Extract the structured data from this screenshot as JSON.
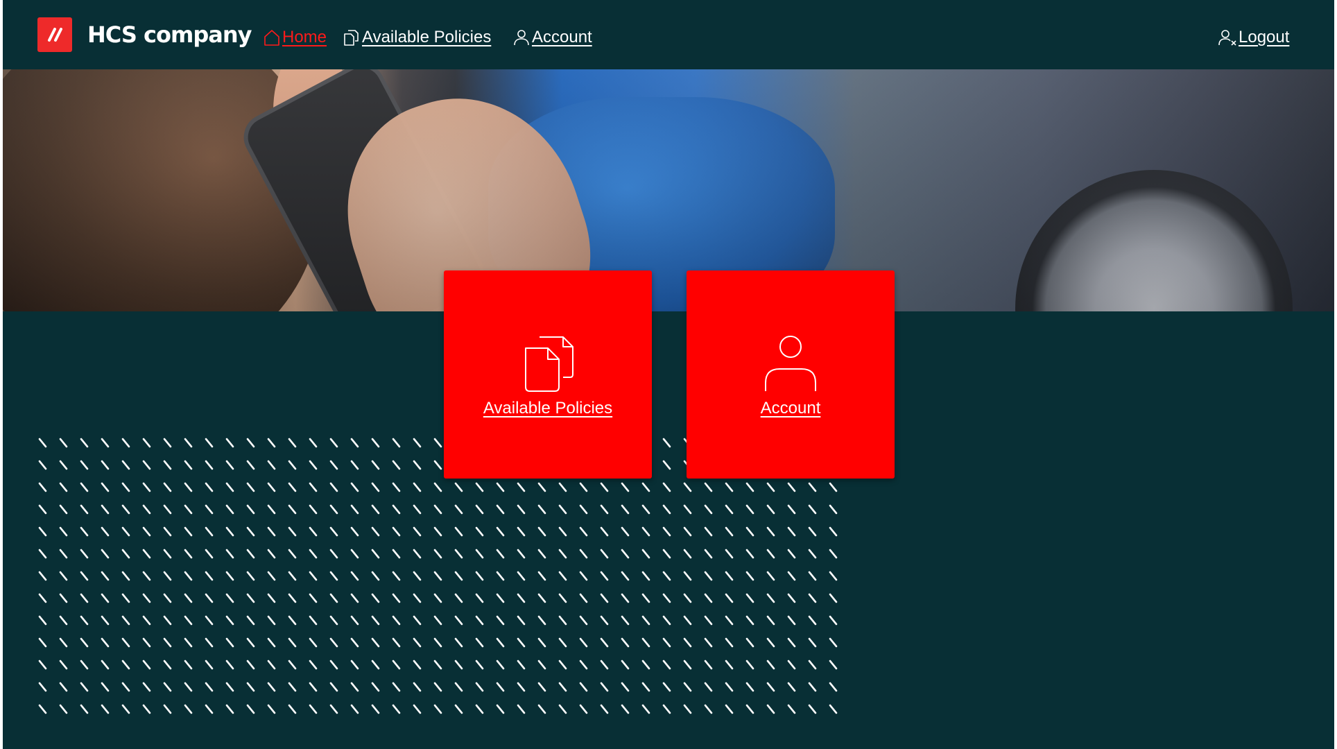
{
  "brand": {
    "name": "HCS company",
    "logo_icon": "double-slash-logo",
    "accent_color": "#ee2a2a"
  },
  "nav": {
    "home": {
      "label": "Home",
      "icon": "home-icon",
      "active": true,
      "color": "#ff1a1a"
    },
    "policies": {
      "label": "Available Policies",
      "icon": "documents-icon"
    },
    "account": {
      "label": "Account",
      "icon": "user-icon"
    },
    "logout": {
      "label": "Logout",
      "icon": "user-remove-icon"
    }
  },
  "hero": {
    "image": "woman on phone beside crashed cars"
  },
  "cards": [
    {
      "label": "Available Policies",
      "icon": "documents-icon"
    },
    {
      "label": "Account",
      "icon": "user-icon"
    }
  ],
  "colors": {
    "background": "#082f35",
    "card": "#ff0000",
    "text": "#ffffff"
  }
}
